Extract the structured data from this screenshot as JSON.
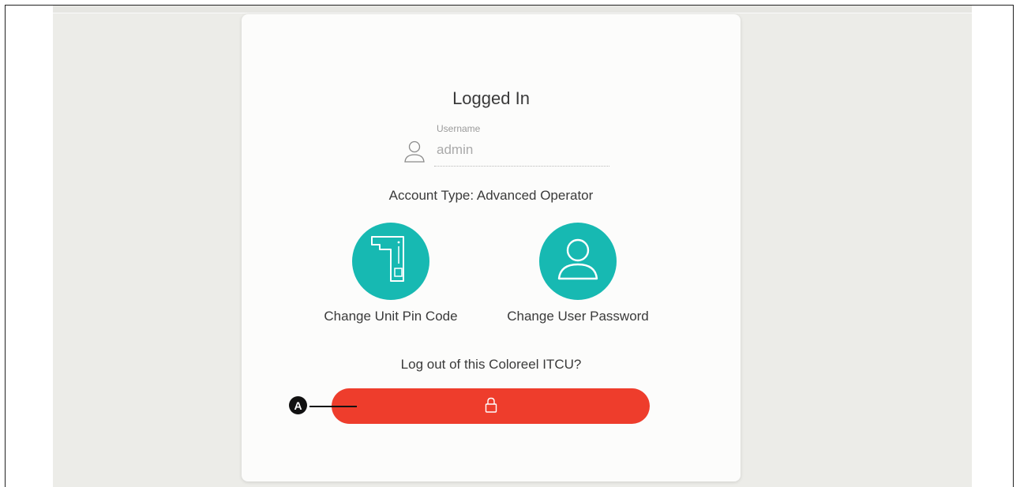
{
  "login": {
    "title": "Logged In",
    "username": {
      "label": "Username",
      "value": "admin",
      "icon": "user-outline-icon"
    },
    "account_type": "Account Type: Advanced Operator",
    "actions": [
      {
        "label": "Change Unit Pin Code",
        "icon": "unit-device-icon"
      },
      {
        "label": "Change User Password",
        "icon": "user-icon"
      }
    ],
    "logout_question": "Log out of this Coloreel ITCU?",
    "logout_button": {
      "icon": "lock-icon",
      "color": "#ee3d2c"
    }
  },
  "callout": {
    "label": "A"
  },
  "colors": {
    "accent": "#17b9b2",
    "danger": "#ee3d2c",
    "background": "#ecece8",
    "card": "#fcfcfb"
  }
}
